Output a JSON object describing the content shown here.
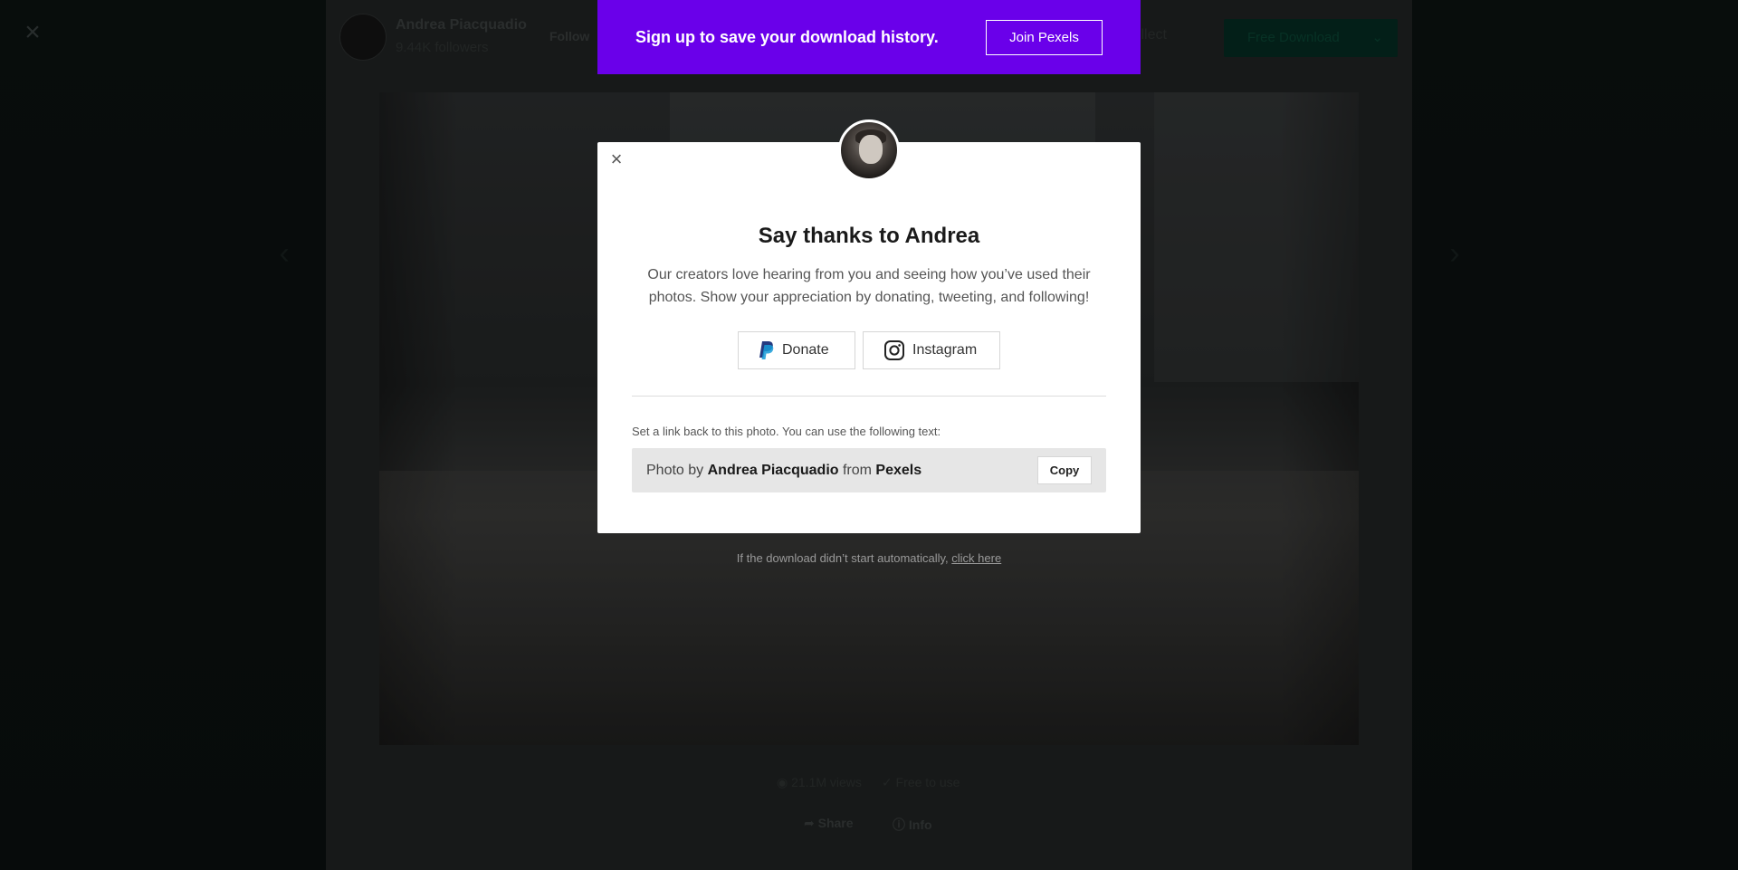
{
  "background": {
    "author_name": "Andrea Piacquadio",
    "author_followers": "9.44K followers",
    "follow_label": "Follow",
    "collect_label": "Collect",
    "download_label": "Free Download",
    "stats": {
      "views": "21.1M views",
      "license": "Free to use"
    },
    "actions": {
      "share": "Share",
      "info": "Info"
    }
  },
  "signup_banner": {
    "text": "Sign up to save your download history.",
    "button_label": "Join Pexels",
    "color": "#6a00ea"
  },
  "modal": {
    "title": "Say thanks to Andrea",
    "description": "Our creators love hearing from you and seeing how you’ve used their photos. Show your appreciation by donating, tweeting, and following!",
    "buttons": {
      "donate_label": "Donate",
      "instagram_label": "Instagram"
    },
    "attribution": {
      "label": "Set a link back to this photo. You can use the following text:",
      "prefix": "Photo by ",
      "author": "Andrea Piacquadio",
      "middle": " from ",
      "site": "Pexels",
      "copy_label": "Copy"
    }
  },
  "download_note": {
    "text": "If the download didn’t start automatically, ",
    "link": "click here"
  },
  "icons": [
    "close-icon",
    "paypal-icon",
    "instagram-icon",
    "chevron-left-icon",
    "chevron-right-icon",
    "eye-icon",
    "check-circle-icon",
    "share-icon",
    "info-icon",
    "chevron-down-icon"
  ]
}
